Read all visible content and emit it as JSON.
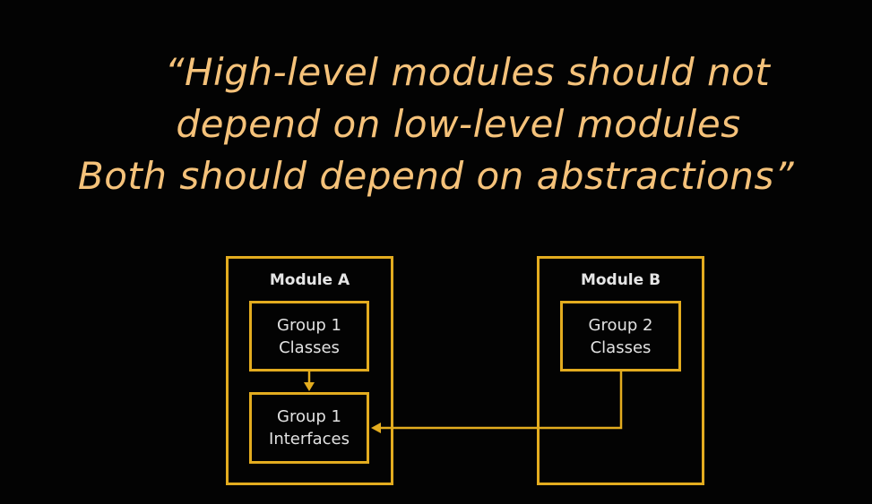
{
  "quote": {
    "line1": "“High-level modules should not",
    "line2": "depend on low-level modules",
    "line3": "Both should depend on abstractions”"
  },
  "diagram": {
    "module_a": {
      "title": "Module A",
      "group_classes": {
        "line1": "Group 1",
        "line2": "Classes"
      },
      "group_interfaces": {
        "line1": "Group 1",
        "line2": "Interfaces"
      }
    },
    "module_b": {
      "title": "Module B",
      "group_classes": {
        "line1": "Group 2",
        "line2": "Classes"
      }
    },
    "accent_color": "#e3ac1f",
    "text_color": "#f5c27a"
  }
}
